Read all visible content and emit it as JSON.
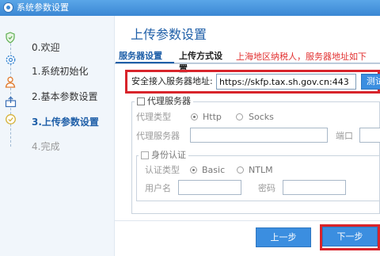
{
  "window": {
    "title": "系统参数设置"
  },
  "sidebar": {
    "steps": [
      {
        "label": "0.欢迎",
        "icon": "shield-icon",
        "state": "done"
      },
      {
        "label": "1.系统初始化",
        "icon": "gear-icon",
        "state": "done"
      },
      {
        "label": "2.基本参数设置",
        "icon": "person-icon",
        "state": "done"
      },
      {
        "label": "3.上传参数设置",
        "icon": "upload-icon",
        "state": "active"
      },
      {
        "label": "4.完成",
        "icon": "check-circle-icon",
        "state": "disabled"
      }
    ]
  },
  "main": {
    "title": "上传参数设置",
    "tabs": [
      {
        "label": "服务器设置",
        "active": true
      },
      {
        "label": "上传方式设置",
        "active": false
      }
    ],
    "notice": "上海地区纳税人，服务器地址如下",
    "server": {
      "label": "安全接入服务器地址:",
      "value": "https://skfp.tax.sh.gov.cn:443",
      "test_button": "测试"
    },
    "proxy": {
      "legend": "代理服务器",
      "type_label": "代理类型",
      "options": [
        "Http",
        "Socks"
      ],
      "selected": "Http",
      "server_label": "代理服务器",
      "port_label": "端口",
      "auth": {
        "legend": "身份认证",
        "type_label": "认证类型",
        "options": [
          "Basic",
          "NTLM"
        ],
        "selected": "Basic",
        "user_label": "用户名",
        "password_label": "密码"
      }
    }
  },
  "footer": {
    "prev_label": "上一步",
    "next_label": "下一步"
  },
  "colors": {
    "accent": "#1f5fa8",
    "button": "#3b8ee0",
    "highlight": "#d8242b",
    "notice": "#e23131"
  }
}
